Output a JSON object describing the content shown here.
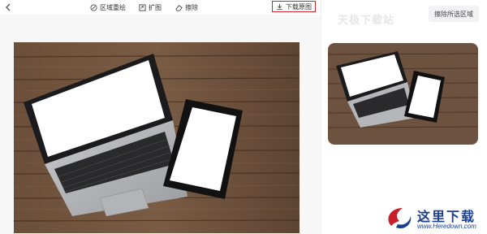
{
  "toolbar": {
    "back_icon": "chevron-left-icon",
    "area_redraw_label": "区域重绘",
    "expand_label": "扩图",
    "erase_label": "擦除",
    "download_label": "下载原图"
  },
  "sidebar": {
    "watermark": "天极下载站",
    "clear_selection_label": "擦除所选区域"
  },
  "logo": {
    "name": "这里下载",
    "url": "www.Heredown.com"
  },
  "colors": {
    "highlight": "#d0252d",
    "logo": "#1b3f8f"
  }
}
